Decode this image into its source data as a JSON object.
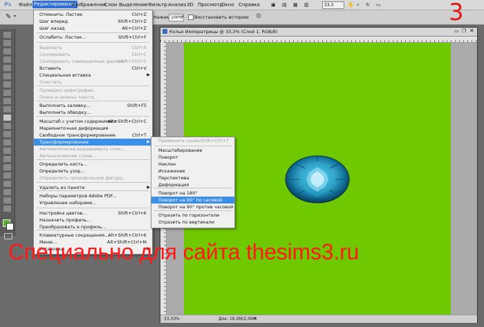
{
  "menubar": {
    "logo": "Ps",
    "items": [
      "Файл",
      "Редактирование",
      "Изображение",
      "Слои",
      "Выделение",
      "Фильтр",
      "Анализ",
      "3D",
      "Просмотр",
      "Окно",
      "Справка"
    ],
    "zoom_value": "33,3"
  },
  "options": {
    "scale_label": "Нажим:",
    "scale_value": "100%",
    "history_label": "Восстановить историю"
  },
  "document": {
    "title": "Колье Императрицы @ 33,3% (Слой 1, RGB/8)",
    "status_zoom": "33,33%",
    "status_doc": "Док: 16,0M/2,00M",
    "canvas_color": "#6fc800"
  },
  "edit_menu": {
    "items": [
      {
        "label": "Отменить: Ластик",
        "shortcut": "Ctrl+Z",
        "state": "normal"
      },
      {
        "label": "Шаг вперед",
        "shortcut": "Shift+Ctrl+Z",
        "state": "normal"
      },
      {
        "label": "Шаг назад",
        "shortcut": "Alt+Ctrl+Z",
        "state": "normal"
      },
      {
        "label": "Ослабить: Ластик...",
        "shortcut": "Shift+Ctrl+F",
        "state": "normal"
      },
      {
        "label": "Вырезать",
        "shortcut": "Ctrl+X",
        "state": "disabled"
      },
      {
        "label": "Скопировать",
        "shortcut": "Ctrl+C",
        "state": "disabled"
      },
      {
        "label": "Скопировать совмещенные данные",
        "shortcut": "Shift+Ctrl+C",
        "state": "disabled"
      },
      {
        "label": "Вставить",
        "shortcut": "Ctrl+V",
        "state": "normal"
      },
      {
        "label": "Специальная вставка",
        "shortcut": "",
        "state": "normal",
        "submenu": true
      },
      {
        "label": "Очистить",
        "shortcut": "",
        "state": "disabled"
      },
      {
        "label": "Проверка орфографии...",
        "shortcut": "",
        "state": "disabled"
      },
      {
        "label": "Поиск и замена текста...",
        "shortcut": "",
        "state": "disabled"
      },
      {
        "label": "Выполнить заливку...",
        "shortcut": "Shift+F5",
        "state": "normal"
      },
      {
        "label": "Выполнить обводку...",
        "shortcut": "",
        "state": "normal"
      },
      {
        "label": "Масштаб с учетом содержимого",
        "shortcut": "Alt+Shift+Ctrl+C",
        "state": "normal"
      },
      {
        "label": "Марионеточная деформация",
        "shortcut": "",
        "state": "normal"
      },
      {
        "label": "Свободное трансформирование",
        "shortcut": "Ctrl+T",
        "state": "normal"
      },
      {
        "label": "Трансформирование",
        "shortcut": "",
        "state": "highlighted",
        "submenu": true
      },
      {
        "label": "Автоматически выравнивать слои...",
        "shortcut": "",
        "state": "disabled"
      },
      {
        "label": "Автоналожение слоев...",
        "shortcut": "",
        "state": "disabled"
      },
      {
        "label": "Определить кисть...",
        "shortcut": "",
        "state": "normal"
      },
      {
        "label": "Определить узор...",
        "shortcut": "",
        "state": "normal"
      },
      {
        "label": "Определить произвольную фигуру...",
        "shortcut": "",
        "state": "disabled"
      },
      {
        "label": "Удалить из памяти",
        "shortcut": "",
        "state": "normal",
        "submenu": true
      },
      {
        "label": "Наборы параметров Adobe PDF...",
        "shortcut": "",
        "state": "normal"
      },
      {
        "label": "Управление наборами...",
        "shortcut": "",
        "state": "normal"
      },
      {
        "label": "Настройка цветов...",
        "shortcut": "Shift+Ctrl+K",
        "state": "normal"
      },
      {
        "label": "Назначить профиль...",
        "shortcut": "",
        "state": "normal"
      },
      {
        "label": "Преобразовать в профиль...",
        "shortcut": "",
        "state": "normal"
      },
      {
        "label": "Клавиатурные сокращения...",
        "shortcut": "Alt+Shift+Ctrl+K",
        "state": "normal"
      },
      {
        "label": "Меню...",
        "shortcut": "Alt+Shift+Ctrl+M",
        "state": "normal"
      },
      {
        "label": "Установки",
        "shortcut": "",
        "state": "normal",
        "submenu": true
      }
    ]
  },
  "transform_menu": {
    "items": [
      {
        "label": "Применить снова",
        "shortcut": "Shift+Ctrl+T",
        "state": "disabled"
      },
      {
        "label": "Масштабирование",
        "shortcut": "",
        "state": "normal"
      },
      {
        "label": "Поворот",
        "shortcut": "",
        "state": "normal"
      },
      {
        "label": "Наклон",
        "shortcut": "",
        "state": "normal"
      },
      {
        "label": "Искажение",
        "shortcut": "",
        "state": "normal"
      },
      {
        "label": "Перспектива",
        "shortcut": "",
        "state": "normal"
      },
      {
        "label": "Деформация",
        "shortcut": "",
        "state": "normal"
      },
      {
        "label": "Поворот на 180°",
        "shortcut": "",
        "state": "normal"
      },
      {
        "label": "Поворот на 90° по часовой",
        "shortcut": "",
        "state": "highlighted"
      },
      {
        "label": "Поворот на 90° против часовой",
        "shortcut": "",
        "state": "normal"
      },
      {
        "label": "Отразить по горизонтали",
        "shortcut": "",
        "state": "normal"
      },
      {
        "label": "Отразить по вертикали",
        "shortcut": "",
        "state": "normal"
      }
    ]
  },
  "overlay": {
    "step_number": "3",
    "watermark": "Специально для сайта thesims3.ru"
  }
}
